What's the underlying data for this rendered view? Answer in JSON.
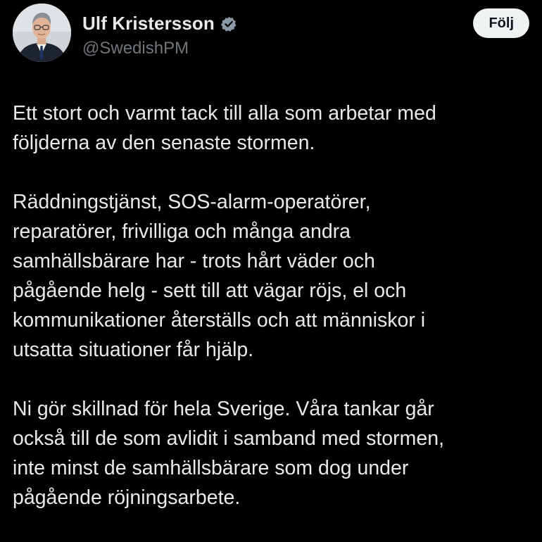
{
  "author": {
    "display_name": "Ulf Kristersson",
    "handle": "@SwedishPM",
    "verified_icon": "verified-badge-icon",
    "avatar_icon": "profile-photo"
  },
  "actions": {
    "follow_label": "Följ"
  },
  "tweet": {
    "paragraphs": [
      "Ett stort och varmt tack till alla som arbetar med\nföljderna av den senaste stormen.",
      "Räddningstjänst, SOS-alarm-operatörer,\nreparatörer, frivilliga och många andra\nsamhällsbärare har - trots hårt väder och\npågående helg - sett till att vägar röjs, el och\nkommunikationer återställs och att människor i\nutsatta situationer får hjälp.",
      "Ni gör skillnad för hela Sverige. Våra tankar går\nockså till de som avlidit i samband med stormen,\ninte minst de samhällsbärare som dog under\npågående röjningsarbete."
    ]
  },
  "colors": {
    "background": "#000000",
    "text_primary": "#e7e9ea",
    "text_secondary": "#71767b",
    "button_bg": "#eff3f4",
    "button_text": "#0f1419"
  }
}
